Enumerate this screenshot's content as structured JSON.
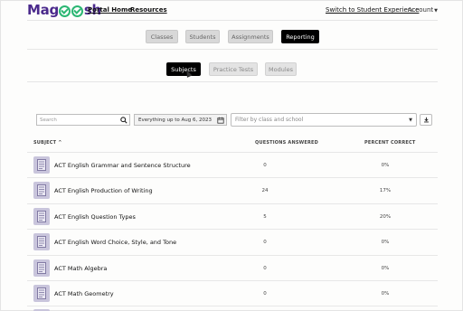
{
  "header": {
    "logo_pre": "Mag",
    "logo_post": "sh",
    "nav": [
      "Portal Home",
      "Resources"
    ],
    "switch_label": "Switch to Student Experience",
    "account_label": "Account"
  },
  "main_tabs": [
    {
      "label": "Classes",
      "active": false
    },
    {
      "label": "Students",
      "active": false
    },
    {
      "label": "Assignments",
      "active": false
    },
    {
      "label": "Reporting",
      "active": true
    }
  ],
  "sub_tabs": [
    {
      "label": "Subjects",
      "active": true
    },
    {
      "label": "Practice Tests",
      "active": false
    },
    {
      "label": "Modules",
      "active": false
    }
  ],
  "filters": {
    "search_placeholder": "Search",
    "date_value": "Everything up to Aug 6, 2023",
    "class_filter_placeholder": "Filter by class and school"
  },
  "table": {
    "headers": {
      "subject": "SUBJECT",
      "questions": "QUESTIONS ANSWERED",
      "percent": "PERCENT CORRECT"
    },
    "rows": [
      {
        "subject": "ACT English Grammar and Sentence Structure",
        "questions": "0",
        "percent": "0%"
      },
      {
        "subject": "ACT English Production of Writing",
        "questions": "24",
        "percent": "17%"
      },
      {
        "subject": "ACT English Question Types",
        "questions": "5",
        "percent": "20%"
      },
      {
        "subject": "ACT English Word Choice, Style, and Tone",
        "questions": "0",
        "percent": "0%"
      },
      {
        "subject": "ACT Math Algebra",
        "questions": "0",
        "percent": "0%"
      },
      {
        "subject": "ACT Math Geometry",
        "questions": "0",
        "percent": "0%"
      }
    ]
  },
  "colors": {
    "brand": "#4b2a8c",
    "brand_accent": "#2bb673",
    "active_tab": "#000000",
    "row_icon": "#c9c5dc"
  }
}
